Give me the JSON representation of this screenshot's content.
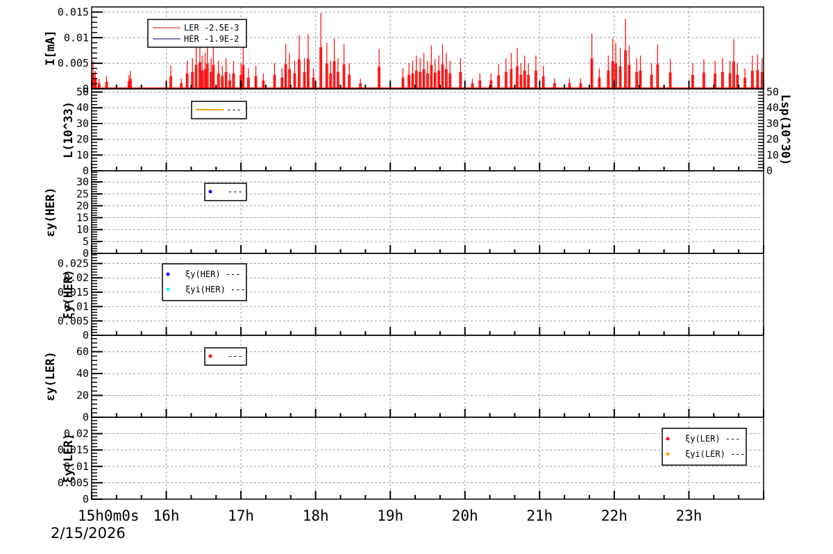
{
  "chart_data": [
    {
      "type": "line",
      "ylabel": "I[mA]",
      "ylim": [
        0,
        0.016
      ],
      "yticks": [
        "0",
        "0.005",
        "0.01",
        "0.015"
      ],
      "ytick_values": [
        0,
        0.005,
        0.01,
        0.015
      ],
      "grid": true,
      "legend_placement": "top-left",
      "series": [
        {
          "name": "LER",
          "legend_value": "-2.5E-3",
          "color": "#ff0000",
          "spikes_hour_value": [
            [
              15.02,
              0.0055
            ],
            [
              15.05,
              0.0035
            ],
            [
              15.1,
              0.002
            ],
            [
              15.2,
              0.0025
            ],
            [
              15.5,
              0.0027
            ],
            [
              15.52,
              0.0035
            ],
            [
              16.06,
              0.0045
            ],
            [
              16.2,
              0.002
            ],
            [
              16.28,
              0.0055
            ],
            [
              16.35,
              0.006
            ],
            [
              16.4,
              0.0085
            ],
            [
              16.45,
              0.0095
            ],
            [
              16.48,
              0.0065
            ],
            [
              16.52,
              0.007
            ],
            [
              16.55,
              0.009
            ],
            [
              16.6,
              0.006
            ],
            [
              16.63,
              0.0085
            ],
            [
              16.7,
              0.0055
            ],
            [
              16.75,
              0.0045
            ],
            [
              16.8,
              0.006
            ],
            [
              16.85,
              0.003
            ],
            [
              16.9,
              0.0055
            ],
            [
              17.0,
              0.005
            ],
            [
              17.03,
              0.0085
            ],
            [
              17.1,
              0.004
            ],
            [
              17.2,
              0.0045
            ],
            [
              17.3,
              0.003
            ],
            [
              17.45,
              0.005
            ],
            [
              17.55,
              0.004
            ],
            [
              17.6,
              0.0088
            ],
            [
              17.65,
              0.007
            ],
            [
              17.72,
              0.0055
            ],
            [
              17.78,
              0.0105
            ],
            [
              17.85,
              0.006
            ],
            [
              17.9,
              0.0107
            ],
            [
              17.97,
              0.004
            ],
            [
              18.07,
              0.0148
            ],
            [
              18.15,
              0.009
            ],
            [
              18.2,
              0.0055
            ],
            [
              18.25,
              0.0098
            ],
            [
              18.3,
              0.006
            ],
            [
              18.38,
              0.0087
            ],
            [
              18.45,
              0.005
            ],
            [
              18.6,
              0.002
            ],
            [
              18.85,
              0.0078
            ],
            [
              19.17,
              0.004
            ],
            [
              19.25,
              0.005
            ],
            [
              19.3,
              0.0055
            ],
            [
              19.35,
              0.0065
            ],
            [
              19.4,
              0.006
            ],
            [
              19.45,
              0.007
            ],
            [
              19.5,
              0.0055
            ],
            [
              19.55,
              0.0085
            ],
            [
              19.6,
              0.0058
            ],
            [
              19.65,
              0.0065
            ],
            [
              19.7,
              0.0087
            ],
            [
              19.75,
              0.007
            ],
            [
              19.8,
              0.0055
            ],
            [
              19.94,
              0.006
            ],
            [
              20.1,
              0.002
            ],
            [
              20.2,
              0.003
            ],
            [
              20.35,
              0.003
            ],
            [
              20.45,
              0.0048
            ],
            [
              20.55,
              0.006
            ],
            [
              20.62,
              0.007
            ],
            [
              20.7,
              0.008
            ],
            [
              20.75,
              0.005
            ],
            [
              20.8,
              0.0065
            ],
            [
              20.85,
              0.005
            ],
            [
              20.95,
              0.0065
            ],
            [
              21.05,
              0.0045
            ],
            [
              21.2,
              0.002
            ],
            [
              21.4,
              0.002
            ],
            [
              21.55,
              0.002
            ],
            [
              21.7,
              0.0108
            ],
            [
              21.8,
              0.004
            ],
            [
              21.92,
              0.0065
            ],
            [
              21.98,
              0.0098
            ],
            [
              22.02,
              0.009
            ],
            [
              22.08,
              0.008
            ],
            [
              22.15,
              0.0137
            ],
            [
              22.2,
              0.0085
            ],
            [
              22.3,
              0.006
            ],
            [
              22.35,
              0.0065
            ],
            [
              22.5,
              0.005
            ],
            [
              22.58,
              0.0087
            ],
            [
              22.75,
              0.0058
            ],
            [
              23.05,
              0.005
            ],
            [
              23.2,
              0.0058
            ],
            [
              23.35,
              0.0055
            ],
            [
              23.45,
              0.006
            ],
            [
              23.55,
              0.0055
            ],
            [
              23.6,
              0.0097
            ],
            [
              23.65,
              0.005
            ],
            [
              23.75,
              0.004
            ],
            [
              23.85,
              0.0065
            ],
            [
              23.92,
              0.0067
            ],
            [
              23.98,
              0.006
            ]
          ]
        },
        {
          "name": "HER",
          "legend_value": "-1.9E-2",
          "color": "#000080",
          "spikes_hour_value": []
        }
      ]
    },
    {
      "type": "line",
      "ylabel": "L(10^33)",
      "ylabel_right": "Lsp(10^30)",
      "ylim": [
        0,
        52
      ],
      "yticks": [
        "0",
        "10",
        "20",
        "30",
        "40",
        "50"
      ],
      "ytick_values": [
        0,
        10,
        20,
        30,
        40,
        50
      ],
      "legend": [
        {
          "color": "#e8a800",
          "label": "---"
        }
      ]
    },
    {
      "type": "scatter",
      "ylabel": "εy(HER)",
      "ylim": [
        0,
        34.7
      ],
      "yticks": [
        "0",
        "5",
        "10",
        "15",
        "20",
        "25",
        "30"
      ],
      "ytick_values": [
        0,
        5,
        10,
        15,
        20,
        25,
        30
      ],
      "legend": [
        {
          "color": "#0000ff",
          "label": "---"
        }
      ]
    },
    {
      "type": "scatter",
      "ylabel": "ξy(HER)",
      "ylim": [
        0,
        0.0285
      ],
      "yticks": [
        "0",
        "0.005",
        "0.01",
        "0.015",
        "0.02",
        "0.025"
      ],
      "ytick_values": [
        0,
        0.005,
        0.01,
        0.015,
        0.02,
        0.025
      ],
      "legend": [
        {
          "color": "#0000ff",
          "label": "ξy(HER) ---"
        },
        {
          "color": "#00ffff",
          "label": "ξyi(HER) ---"
        }
      ]
    },
    {
      "type": "scatter",
      "ylabel": "εy(LER)",
      "ylim": [
        0,
        75
      ],
      "yticks": [
        "0",
        "20",
        "40",
        "60"
      ],
      "ytick_values": [
        0,
        20,
        40,
        60
      ],
      "legend": [
        {
          "color": "#ff0000",
          "label": "---"
        }
      ]
    },
    {
      "type": "scatter",
      "ylabel": "ξy(LER)",
      "ylim": [
        0,
        0.025
      ],
      "yticks": [
        "0",
        "0.005",
        "0.01",
        "0.015",
        "0.02"
      ],
      "ytick_values": [
        0,
        0.005,
        0.01,
        0.015,
        0.02
      ],
      "legend": [
        {
          "color": "#ff0000",
          "label": "ξy(LER) ---"
        },
        {
          "color": "#ffa500",
          "label": "ξyi(LER) ---"
        }
      ]
    }
  ],
  "x_axis": {
    "range_hours": [
      15,
      24
    ],
    "tick_labels": [
      "15h0m0s",
      "16h",
      "17h",
      "18h",
      "19h",
      "20h",
      "21h",
      "22h",
      "23h"
    ],
    "tick_hours": [
      15,
      16,
      17,
      18,
      19,
      20,
      21,
      22,
      23
    ],
    "date": "2/15/2026"
  }
}
